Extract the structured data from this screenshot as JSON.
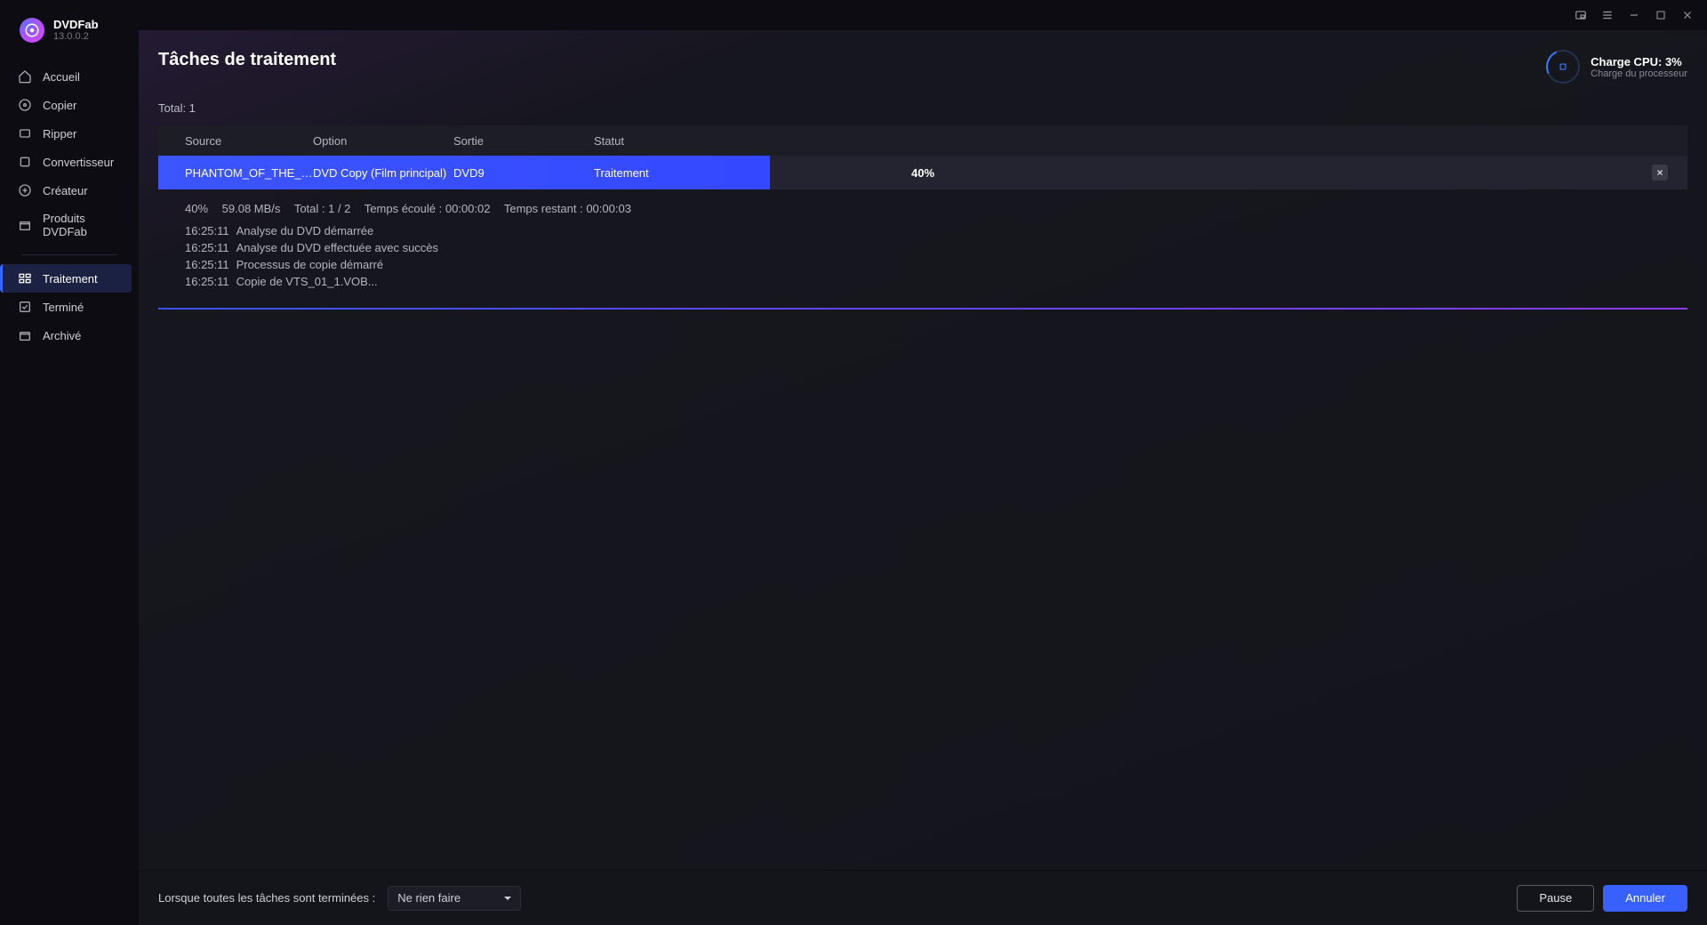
{
  "app": {
    "name": "DVDFab",
    "version": "13.0.0.2"
  },
  "sidebar": {
    "items": [
      {
        "label": "Accueil"
      },
      {
        "label": "Copier"
      },
      {
        "label": "Ripper"
      },
      {
        "label": "Convertisseur"
      },
      {
        "label": "Créateur"
      },
      {
        "label": "Produits DVDFab"
      },
      {
        "label": "Traitement"
      },
      {
        "label": "Terminé"
      },
      {
        "label": "Archivé"
      }
    ]
  },
  "page": {
    "title": "Tâches de traitement",
    "total_label": "Total: 1",
    "cpu": {
      "line1": "Charge CPU: 3%",
      "line2": "Charge du processeur"
    }
  },
  "columns": {
    "source": "Source",
    "option": "Option",
    "sortie": "Sortie",
    "statut": "Statut"
  },
  "task": {
    "source": "PHANTOM_OF_THE_OP...",
    "option": "DVD Copy (Film principal)",
    "sortie": "DVD9",
    "statut": "Traitement",
    "percent_text": "40%",
    "percent": 40
  },
  "stats": {
    "pct": "40%",
    "speed": "59.08 MB/s",
    "total": "Total : 1 / 2",
    "elapsed": "Temps écoulé : 00:00:02",
    "remaining": "Temps restant : 00:00:03"
  },
  "log": [
    {
      "time": "16:25:11",
      "msg": "Analyse du DVD démarrée"
    },
    {
      "time": "16:25:11",
      "msg": "Analyse du DVD effectuée avec succès"
    },
    {
      "time": "16:25:11",
      "msg": "Processus de copie démarré"
    },
    {
      "time": "16:25:11",
      "msg": "Copie de VTS_01_1.VOB..."
    }
  ],
  "footer": {
    "label": "Lorsque toutes les tâches sont terminées :",
    "select_value": "Ne rien faire",
    "pause": "Pause",
    "cancel": "Annuler"
  }
}
